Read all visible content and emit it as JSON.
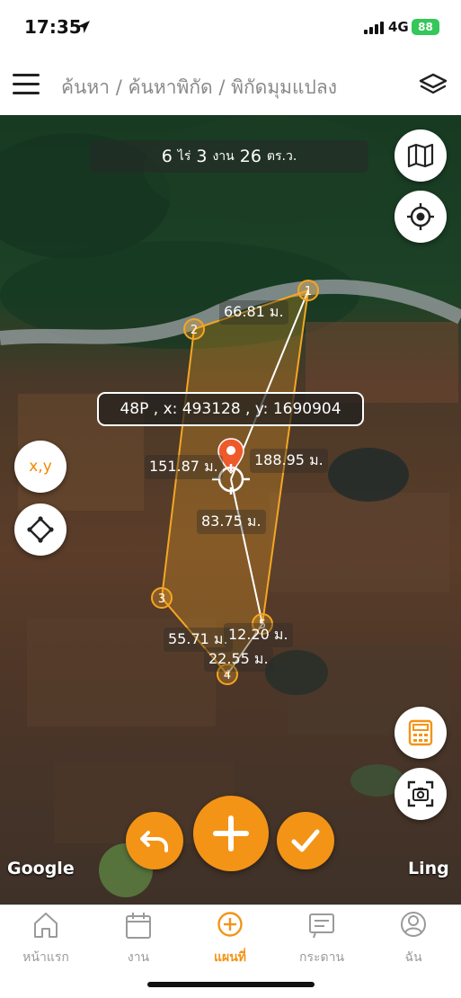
{
  "status_bar": {
    "time": "17:35",
    "network": "4G",
    "battery": "88"
  },
  "header": {
    "breadcrumb": "ค้นหา / ค้นหาพิกัด / พิกัดมุมแปลง",
    "menu_icon": "hamburger-menu-icon",
    "layers_icon": "layers-icon"
  },
  "map": {
    "area": {
      "rai_value": "6",
      "rai_unit": "ไร่",
      "ngan_value": "3",
      "ngan_unit": "งาน",
      "wa_value": "26",
      "wa_unit": "ตร.ว."
    },
    "coordinate_readout": "48P , x: 493128 , y: 1690904",
    "xy_button_label": "x,y",
    "vertices": [
      "1",
      "2",
      "3",
      "4",
      "5"
    ],
    "distances": {
      "side_1_2": "66.81 ม.",
      "side_2_3": "151.87 ม.",
      "pin_to_vertex_1": "188.95 ม.",
      "pin_to_vertex_5": "83.75 ม.",
      "side_3_4": "55.71 ม.",
      "side_4_5_a": "12.20 ม.",
      "side_4_5_b": "22.55 ม."
    },
    "attribution_left": "Google",
    "attribution_right": "Ling"
  },
  "tabs": [
    {
      "label": "หน้าแรก",
      "icon": "home-icon",
      "active": false
    },
    {
      "label": "งาน",
      "icon": "calendar-icon",
      "active": false
    },
    {
      "label": "แผนที่",
      "icon": "plus-circle-icon",
      "active": true
    },
    {
      "label": "กระดาน",
      "icon": "board-icon",
      "active": false
    },
    {
      "label": "ฉัน",
      "icon": "user-icon",
      "active": false
    }
  ],
  "colors": {
    "accent": "#f39416",
    "polygon_stroke": "#f5a623",
    "pin": "#ef5a2a"
  }
}
